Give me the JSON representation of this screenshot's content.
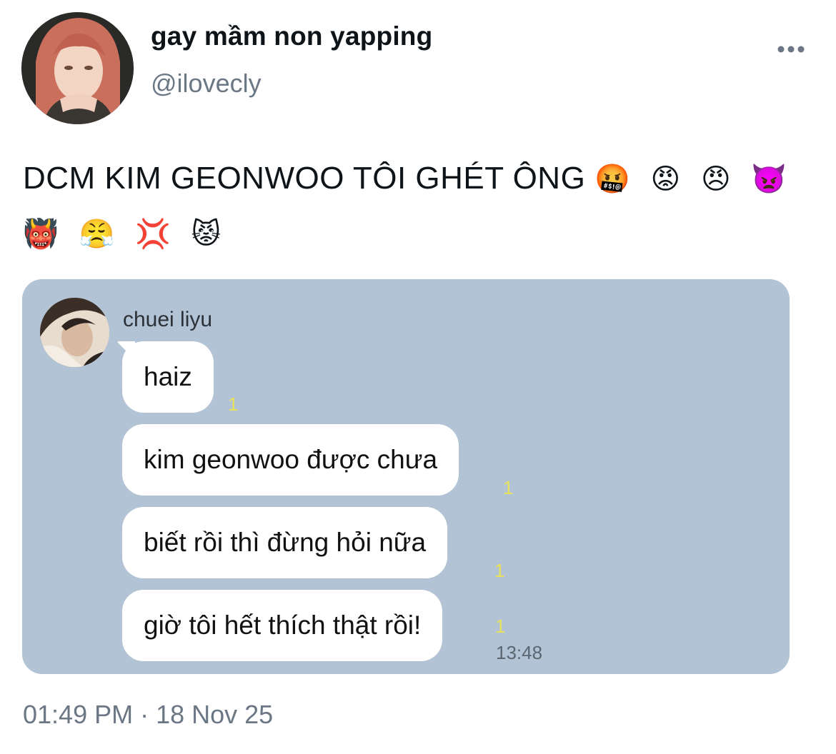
{
  "author": {
    "display_name": "gay mầm non yapping",
    "handle": "@ilovecly"
  },
  "tweet": {
    "text": "DCM KIM GEONWOO TÔI GHÉT ÔNG",
    "emojis_line1": "🤬 😡 😠 👿",
    "emojis_line2": "👹 😤 💢 😾",
    "timestamp": "01:49 PM · 18 Nov 25"
  },
  "chat": {
    "background_color": "#b1c3d4",
    "sender": "chuei liyu",
    "messages": [
      {
        "text": "haiz",
        "read_count": "1"
      },
      {
        "text": "kim geonwoo được chưa",
        "read_count": "1"
      },
      {
        "text": "biết rồi thì đừng hỏi nữa",
        "read_count": "1"
      },
      {
        "text": "giờ tôi hết thích thật rồi!",
        "read_count": "1"
      }
    ],
    "time": "13:48"
  },
  "icons": {
    "more": "more-horizontal-icon"
  }
}
